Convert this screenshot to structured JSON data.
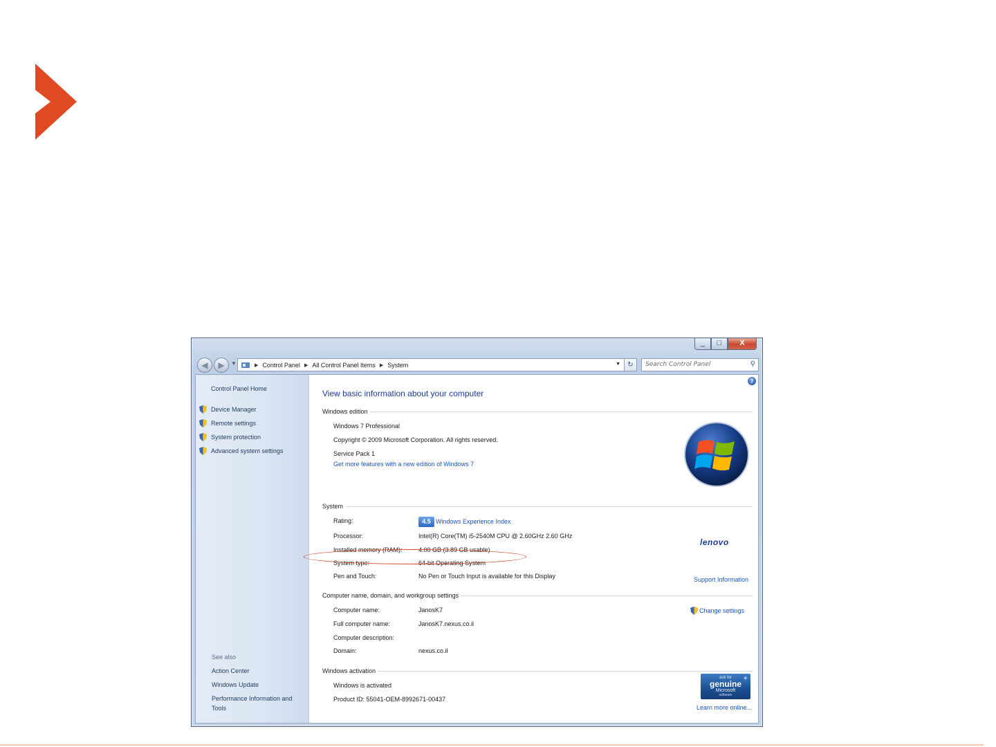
{
  "colors": {
    "brand_orange": "#e04a22",
    "link_blue": "#1c54b8",
    "title_blue": "#1e3b8e",
    "highlight_red": "#d34c2c"
  },
  "window": {
    "caption_buttons": [
      "_",
      "□",
      "X"
    ],
    "breadcrumb": [
      "Control Panel",
      "All Control Panel Items",
      "System"
    ],
    "search_placeholder": "Search Control Panel"
  },
  "left_pane": {
    "home": "Control Panel Home",
    "tasks": [
      {
        "label": "Device Manager",
        "icon": "shield-icon"
      },
      {
        "label": "Remote settings",
        "icon": "shield-icon"
      },
      {
        "label": "System protection",
        "icon": "shield-icon"
      },
      {
        "label": "Advanced system settings",
        "icon": "shield-icon"
      }
    ],
    "see_also_heading": "See also",
    "see_also": [
      "Action Center",
      "Windows Update",
      "Performance Information and",
      "Tools"
    ]
  },
  "main": {
    "title": "View basic information about your computer",
    "edition": {
      "heading": "Windows edition",
      "name": "Windows 7 Professional",
      "copyright": "Copyright © 2009 Microsoft Corporation.  All rights reserved.",
      "service_pack": "Service Pack 1",
      "upgrade_link": "Get more features with a new edition of Windows 7"
    },
    "system": {
      "heading": "System",
      "rating_label": "Rating:",
      "rating_score": "4.5",
      "rating_link": "Windows Experience Index",
      "processor_label": "Processor:",
      "processor_value": "Intel(R) Core(TM) i5-2540M CPU @ 2.60GHz   2.60 GHz",
      "memory_label": "Installed memory (RAM):",
      "memory_value": "4.00 GB (3.89 GB usable)",
      "type_label": "System type:",
      "type_value": "64-bit Operating System",
      "pen_label": "Pen and Touch:",
      "pen_value": "No Pen or Touch Input is available for this Display",
      "oem_logo": "lenovo",
      "support_link": "Support Information"
    },
    "computer_name": {
      "heading": "Computer name, domain, and workgroup settings",
      "name_label": "Computer name:",
      "name_value": "JanosK7",
      "full_label": "Full computer name:",
      "full_value": "JanosK7.nexus.co.il",
      "desc_label": "Computer description:",
      "domain_label": "Domain:",
      "domain_value": "nexus.co.il",
      "change_link": "Change settings"
    },
    "activation": {
      "heading": "Windows activation",
      "status": "Windows is activated",
      "product_id": "Product ID: 55041-OEM-8992671-00437",
      "genuine_small": "ask for",
      "genuine_main": "genuine",
      "genuine_ms": "Microsoft",
      "genuine_sw": "software",
      "learn_link": "Learn more online..."
    }
  }
}
